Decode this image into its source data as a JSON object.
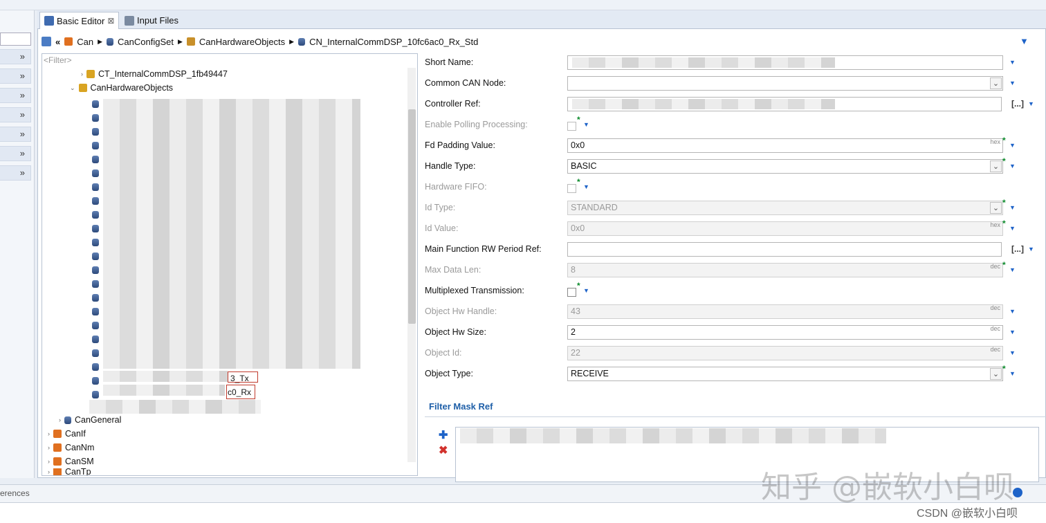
{
  "tabs": [
    {
      "label": "Basic Editor",
      "close": "⊠"
    },
    {
      "label": "Input Files"
    }
  ],
  "breadcrumb": [
    "Can",
    "CanConfigSet",
    "CanHardwareObjects",
    "CN_InternalCommDSP_10fc6ac0_Rx_Std"
  ],
  "tree": {
    "filter_placeholder": "<Filter>",
    "nodes": [
      "CT_InternalCommDSP_1fb49447",
      "CanHardwareObjects",
      "CanGeneral",
      "CanIf",
      "CanNm",
      "CanSM",
      "CanTp"
    ],
    "tx_suffix": "3_Tx",
    "rx_suffix": "c0_Rx"
  },
  "form": {
    "fields": [
      {
        "label": "Short Name:",
        "value": ""
      },
      {
        "label": "Common CAN Node:",
        "value": ""
      },
      {
        "label": "Controller Ref:",
        "value": ""
      },
      {
        "label": "Enable Polling Processing:",
        "value": ""
      },
      {
        "label": "Fd Padding Value:",
        "value": "0x0",
        "unit": "hex"
      },
      {
        "label": "Handle Type:",
        "value": "BASIC"
      },
      {
        "label": "Hardware FIFO:",
        "value": ""
      },
      {
        "label": "Id Type:",
        "value": "STANDARD"
      },
      {
        "label": "Id Value:",
        "value": "0x0",
        "unit": "hex"
      },
      {
        "label": "Main Function RW Period Ref:",
        "value": ""
      },
      {
        "label": "Max Data Len:",
        "value": "8",
        "unit": "dec"
      },
      {
        "label": "Multiplexed Transmission:",
        "value": ""
      },
      {
        "label": "Object Hw Handle:",
        "value": "43",
        "unit": "dec"
      },
      {
        "label": "Object Hw Size:",
        "value": "2",
        "unit": "dec"
      },
      {
        "label": "Object Id:",
        "value": "22",
        "unit": "dec"
      },
      {
        "label": "Object Type:",
        "value": "RECEIVE"
      }
    ],
    "ref_button": "[...]",
    "section_title": "Filter Mask Ref"
  },
  "status": {
    "left_text": "erences"
  },
  "watermark": "知乎 @嵌软小白呗",
  "csdn": "CSDN @嵌软小白呗",
  "colors": {
    "accent": "#1e63c8",
    "star": "#0a8a2a",
    "section": "#1e5fa8"
  }
}
